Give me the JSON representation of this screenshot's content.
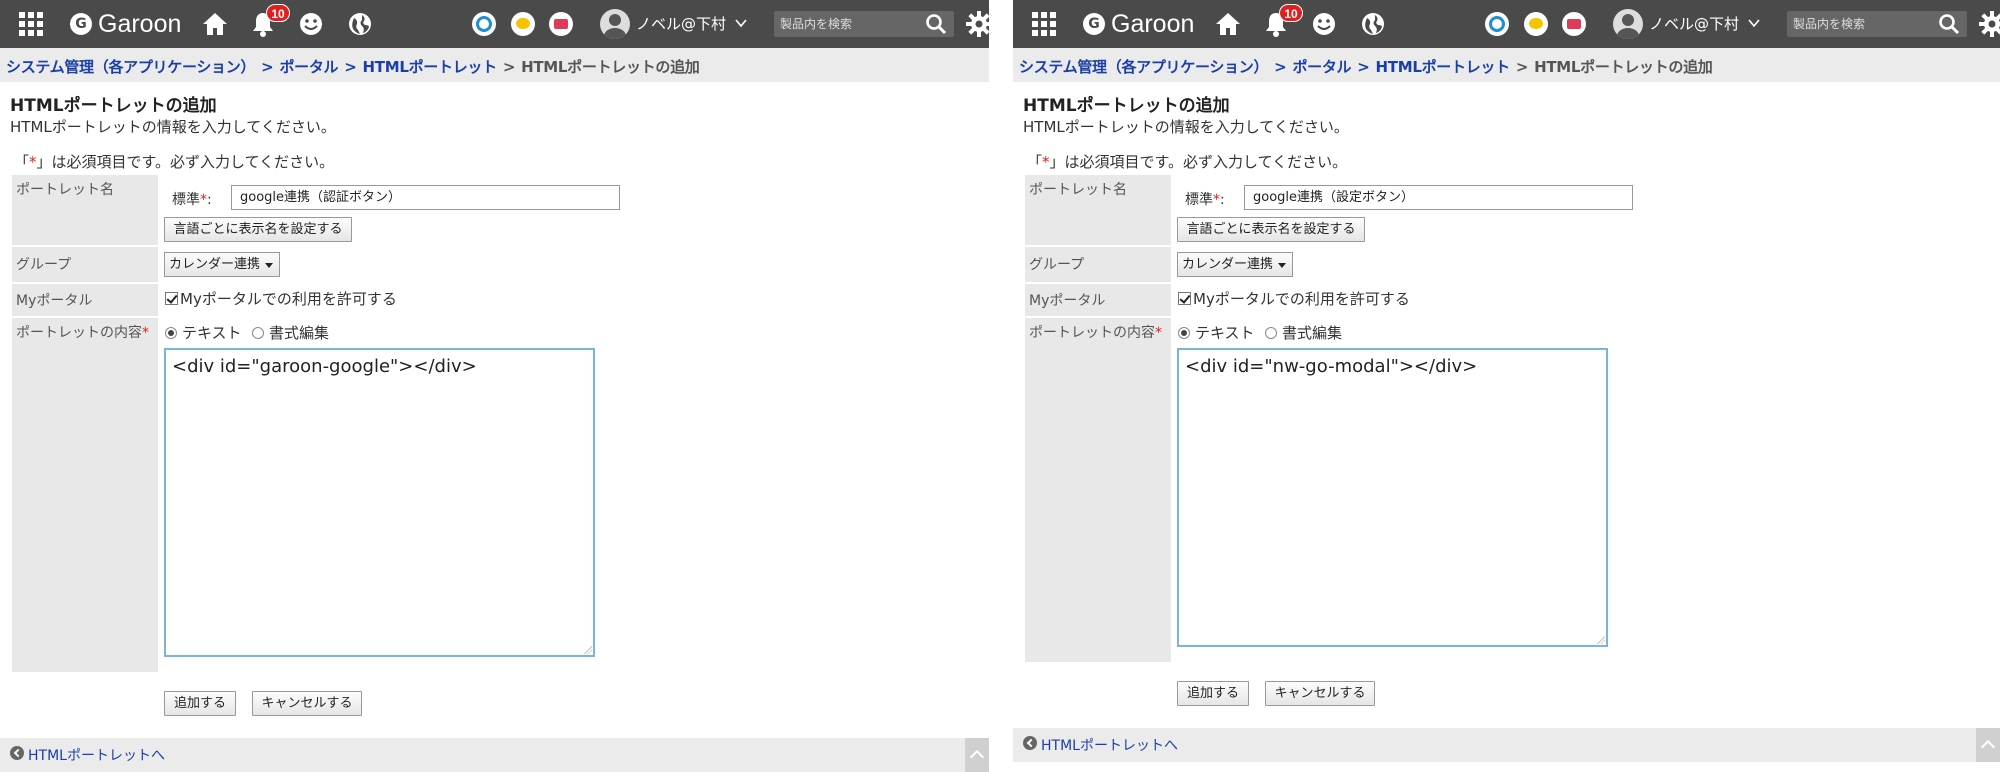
{
  "header": {
    "logo_text": "Garoon",
    "logo_mark": "G",
    "notification_count": "10",
    "user_name": "ノベル@下村",
    "search_placeholder": "製品内を検索",
    "icons": [
      "apps-grid-icon",
      "home-icon",
      "bell-icon",
      "smile-icon",
      "globe-icon",
      "circle-blue-icon",
      "chat-yellow-icon",
      "mail-red-icon",
      "user-icon",
      "search-icon",
      "gear-icon"
    ]
  },
  "breadcrumb": {
    "system": "システム管理（各アプリケーション）",
    "portal": "ポータル",
    "html_portlet": "HTMLポートレット",
    "current": "HTMLポートレットの追加",
    "sep": ">"
  },
  "page": {
    "title": "HTMLポートレットの追加",
    "desc": "HTMLポートレットの情報を入力してください。",
    "req_open": "「",
    "req_star": "*",
    "req_close": "」は必須項目です。必ず入力してください。"
  },
  "form": {
    "portlet_name_label": "ポートレット名",
    "standard_label": "標準",
    "standard_star": "*",
    "standard_colon": ":",
    "lang_button": "言語ごとに表示名を設定する",
    "group_label": "グループ",
    "group_value": "カレンダー連携",
    "myportal_label": "Myポータル",
    "myportal_check": "Myポータルでの利用を許可する",
    "content_label": "ポートレットの内容",
    "content_star": "*",
    "radio_text": "テキスト",
    "radio_format": "書式編集",
    "add_button": "追加する",
    "cancel_button": "キャンセルする",
    "back_link": "HTMLポートレットへ"
  },
  "panels": [
    {
      "portlet_name_value": "google連携（認証ボタン）",
      "content": "<div id=\"garoon-google\"></div>"
    },
    {
      "portlet_name_value": "google連携（設定ボタン）",
      "content": "<div id=\"nw-go-modal\"></div>"
    }
  ]
}
